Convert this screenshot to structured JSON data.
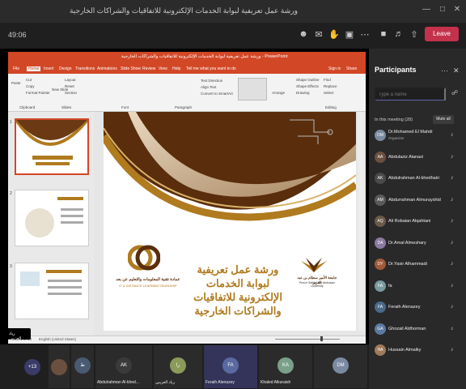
{
  "window": {
    "title": "ورشة عمل تعريفية لبوابة الخدمات الإلكترونية للاتفاقيات والشراكات الخارجية",
    "controls": [
      "minimize-icon",
      "maximize-icon",
      "close-icon"
    ]
  },
  "toolbar": {
    "timer": "49:06",
    "leave_label": "Leave",
    "buttons": [
      "people-icon",
      "chat-icon",
      "raise-hand-icon",
      "rooms-icon",
      "more-icon",
      "camera-off-icon",
      "mic-off-icon",
      "share-icon"
    ],
    "leave_color": "#c4314b"
  },
  "powerpoint": {
    "title_bar": "ورشة عمل تعريفية لبوابة الخدمات الإلكترونية للاتفاقيات والشراكات الخارجية - PowerPoint",
    "tabs": [
      "File",
      "Home",
      "Insert",
      "Design",
      "Transitions",
      "Animations",
      "Slide Show",
      "Review",
      "View",
      "Help",
      "Tell me what you want to do"
    ],
    "sign_in": "Sign in",
    "share": "Share",
    "ribbon": {
      "clipboard": [
        "Paste",
        "Cut",
        "Copy",
        "Format Painter",
        "Clipboard"
      ],
      "slides": [
        "New Slide",
        "Layout",
        "Reset",
        "Section",
        "Slides"
      ],
      "font": "Font",
      "paragraph": [
        "Text Direction",
        "Align Text",
        "Convert to SmartArt",
        "Paragraph"
      ],
      "drawing": [
        "Arrange",
        "Quick Styles",
        "Shape Fill",
        "Shape Outline",
        "Shape Effects",
        "Drawing"
      ],
      "editing": [
        "Find",
        "Replace",
        "Select",
        "Editing"
      ]
    },
    "thumb_numbers": [
      "1",
      "2",
      "3"
    ],
    "status_left": "Slide 1 of 14",
    "status_lang": "English (United States)",
    "slide": {
      "heading": "ورشة عمل تعريفية لبوابة الخدمات الإلكترونية للاتفاقيات والشراكات الخارجية",
      "logo_left_ar": "عمادة تقنية المعلومات والتعليم عن بعد",
      "logo_left_en": "IT & DISTANCE LEARNING DEANSHIP",
      "logo_right_ar": "جامعة الأمير سطام بن عبد العزيز",
      "logo_right_en": "Prince Sattam Bin Abdulaziz University",
      "accent": "#b07a1e",
      "dark": "#5a2d0c"
    },
    "sharer_name": "رياد العزيبي"
  },
  "participants": {
    "title": "Participants",
    "search_placeholder": "Type a name",
    "in_meeting": "In this meeting (28)",
    "mute_all": "Mute all",
    "list": [
      {
        "name": "Dr.Mohamed El Mahdi",
        "sub": "Organizer",
        "initials": "DM",
        "color": "#7a8aa0"
      },
      {
        "name": "Abdulaziz Alanazi",
        "sub": "",
        "initials": "AA",
        "color": "#6b5040"
      },
      {
        "name": "Abdulrahman Al-khedhairi",
        "sub": "",
        "initials": "AK",
        "color": "#4a4a4a"
      },
      {
        "name": "Abdurrahman Almurayshid",
        "sub": "",
        "initials": "AM",
        "color": "#5a5a5a"
      },
      {
        "name": "Ali Robaian Alqahtani",
        "sub": "",
        "initials": "AQ",
        "color": "#6a5a4a"
      },
      {
        "name": "Dr.Amal Almeshary",
        "sub": "",
        "initials": "DA",
        "color": "#8b7aa0"
      },
      {
        "name": "Dr.Yasir Alhammadi",
        "sub": "",
        "initials": "DY",
        "color": "#a05a3a"
      },
      {
        "name": "fa",
        "sub": "",
        "initials": "FA",
        "color": "#7a9aa0"
      },
      {
        "name": "Feraih Alenazey",
        "sub": "",
        "initials": "FA",
        "color": "#4a6a8a"
      },
      {
        "name": "Ghozail Aldhorman",
        "sub": "",
        "initials": "GA",
        "color": "#5a7aa0"
      },
      {
        "name": "Hussain Almalky",
        "sub": "",
        "initials": "HA",
        "color": "#a07a5a"
      }
    ]
  },
  "strip": {
    "more_count": "+13",
    "tiles": [
      {
        "label": "",
        "initials": "ط",
        "color": "#4a5a70"
      },
      {
        "label": "Abdulrahman Al-khed...",
        "initials": "AK",
        "color": "#3a3a3a"
      },
      {
        "label": "رياد العزيبي",
        "initials": "را",
        "color": "#8a9a5a"
      },
      {
        "label": "Feraih Alenazey",
        "initials": "FA",
        "color": "#5a6aa0"
      },
      {
        "label": "Khaled Alkuraish",
        "initials": "KA",
        "color": "#7aa08a"
      },
      {
        "label": "",
        "initials": "DM",
        "color": "#7a8aa0"
      }
    ]
  }
}
